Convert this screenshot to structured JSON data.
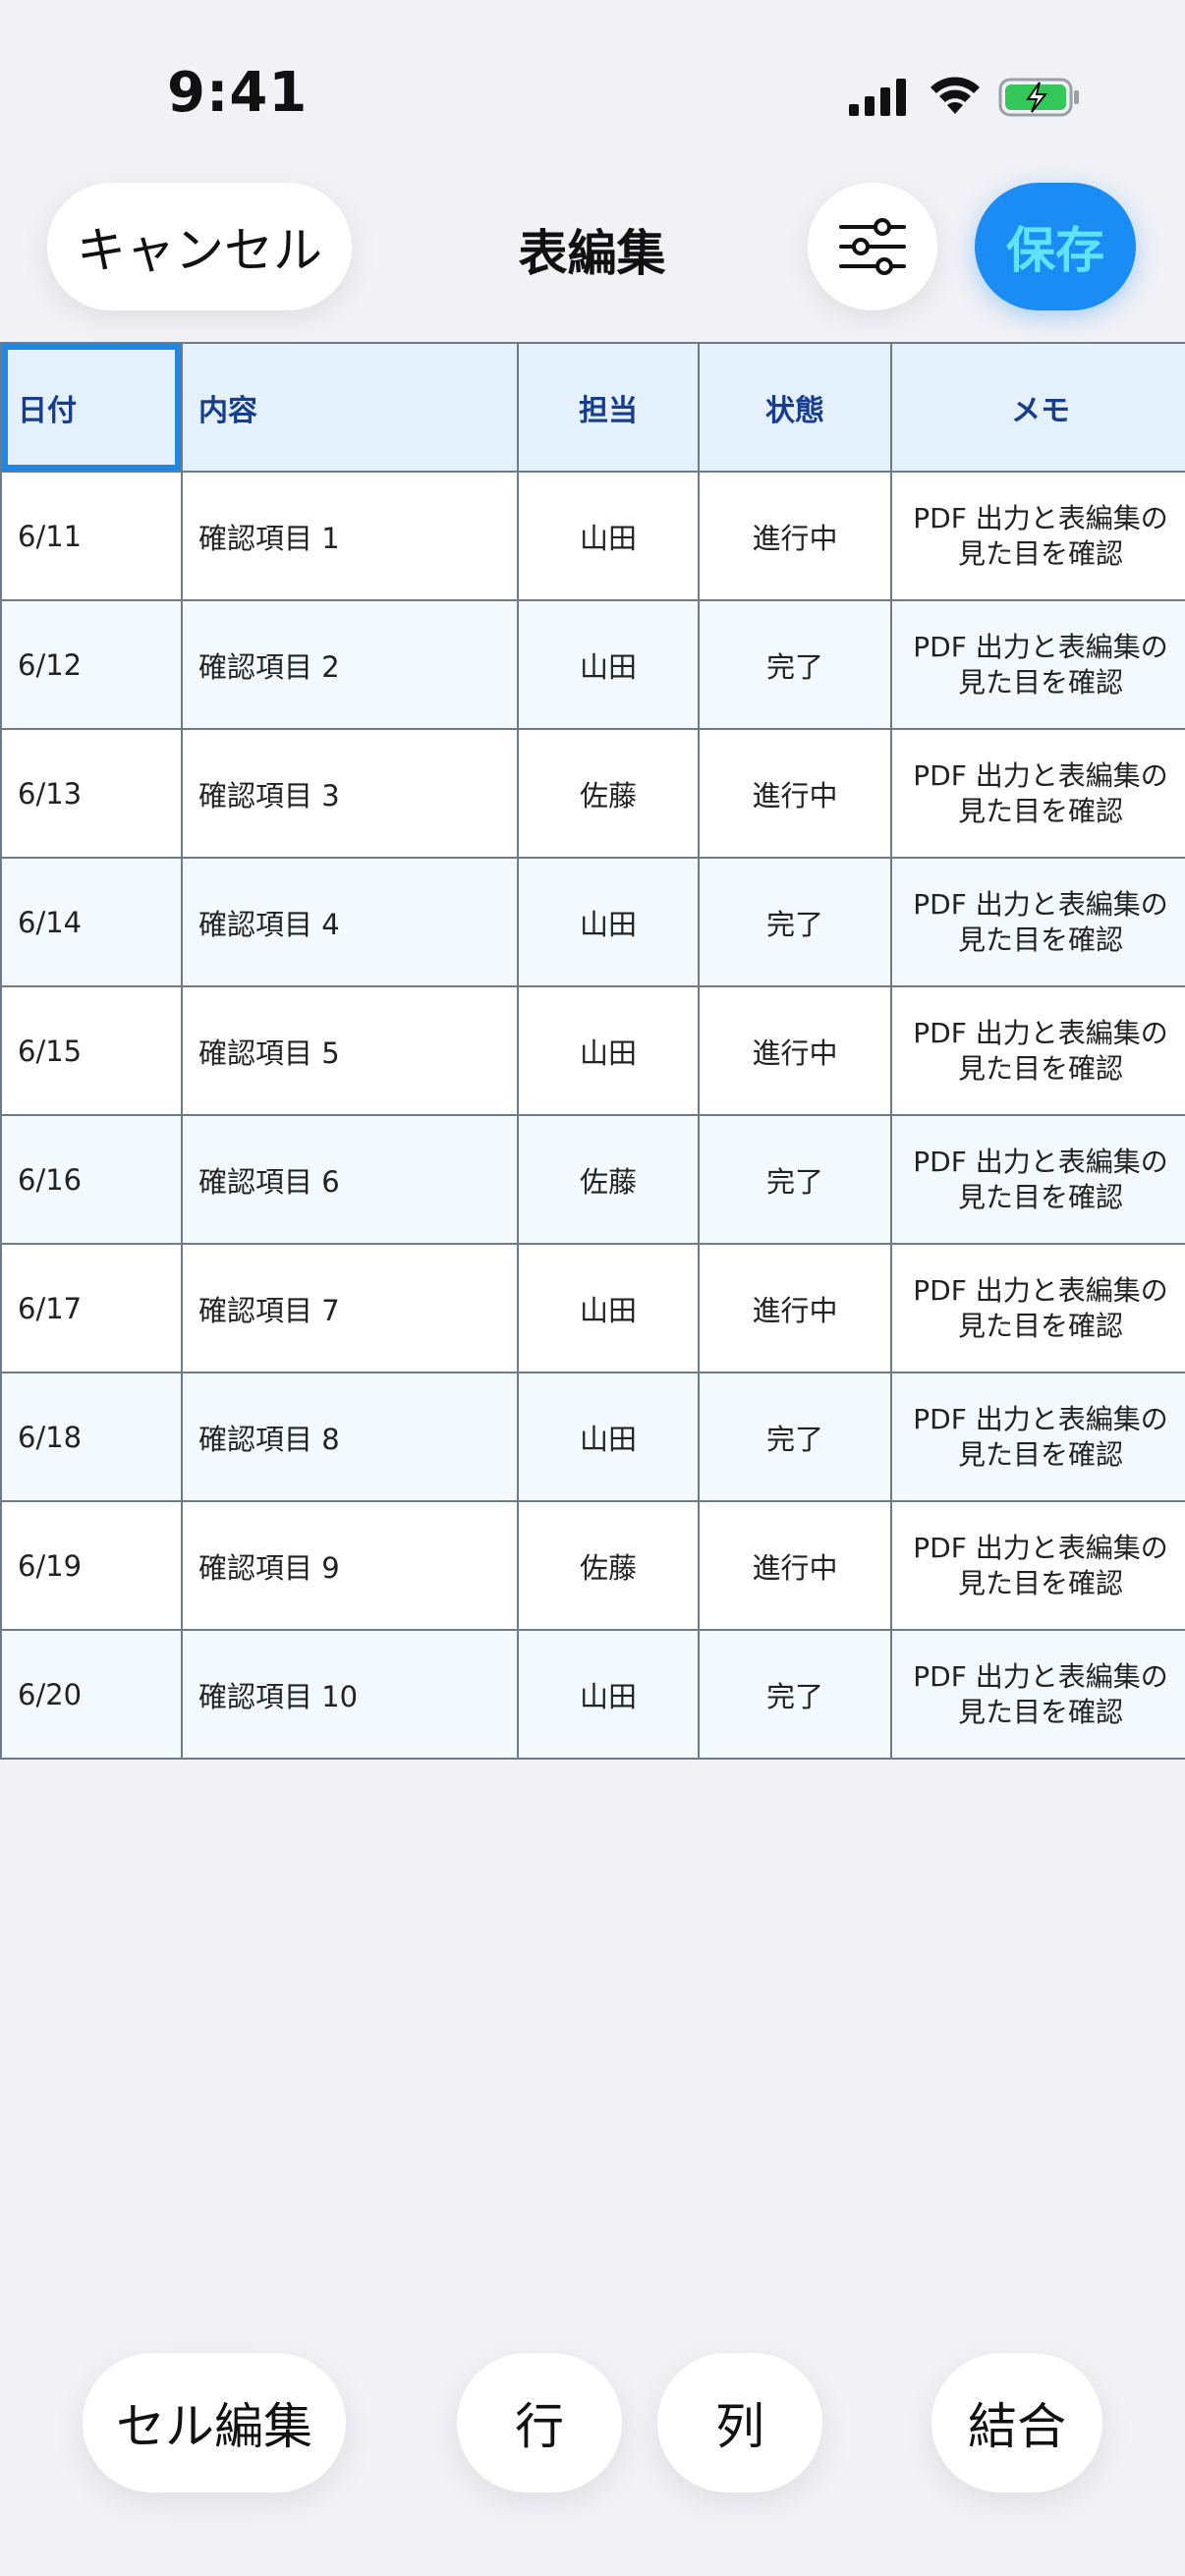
{
  "status_bar": {
    "time": "9:41"
  },
  "nav": {
    "cancel_label": "キャンセル",
    "title": "表編集",
    "save_label": "保存"
  },
  "table": {
    "headers": [
      "日付",
      "内容",
      "担当",
      "状態",
      "メモ"
    ],
    "rows": [
      [
        "6/11",
        "確認項目 1",
        "山田",
        "進行中",
        "PDF 出力と表編集の見た目を確認"
      ],
      [
        "6/12",
        "確認項目 2",
        "山田",
        "完了",
        "PDF 出力と表編集の見た目を確認"
      ],
      [
        "6/13",
        "確認項目 3",
        "佐藤",
        "進行中",
        "PDF 出力と表編集の見た目を確認"
      ],
      [
        "6/14",
        "確認項目 4",
        "山田",
        "完了",
        "PDF 出力と表編集の見た目を確認"
      ],
      [
        "6/15",
        "確認項目 5",
        "山田",
        "進行中",
        "PDF 出力と表編集の見た目を確認"
      ],
      [
        "6/16",
        "確認項目 6",
        "佐藤",
        "完了",
        "PDF 出力と表編集の見た目を確認"
      ],
      [
        "6/17",
        "確認項目 7",
        "山田",
        "進行中",
        "PDF 出力と表編集の見た目を確認"
      ],
      [
        "6/18",
        "確認項目 8",
        "山田",
        "完了",
        "PDF 出力と表編集の見た目を確認"
      ],
      [
        "6/19",
        "確認項目 9",
        "佐藤",
        "進行中",
        "PDF 出力と表編集の見た目を確認"
      ],
      [
        "6/20",
        "確認項目 10",
        "山田",
        "完了",
        "PDF 出力と表編集の見た目を確認"
      ]
    ],
    "selected_cell": "header-0"
  },
  "toolbar": {
    "cell_edit_label": "セル編集",
    "row_label": "行",
    "column_label": "列",
    "merge_label": "結合"
  },
  "colors": {
    "accent": "#1a8cf4",
    "header_bg": "#e4f0fc",
    "header_text": "#173e8c",
    "selection": "#1f86e2",
    "battery": "#34c759"
  },
  "icons": {
    "signal": "cellular-signal-icon",
    "wifi": "wifi-icon",
    "battery": "battery-charging-icon",
    "settings": "sliders-icon"
  }
}
